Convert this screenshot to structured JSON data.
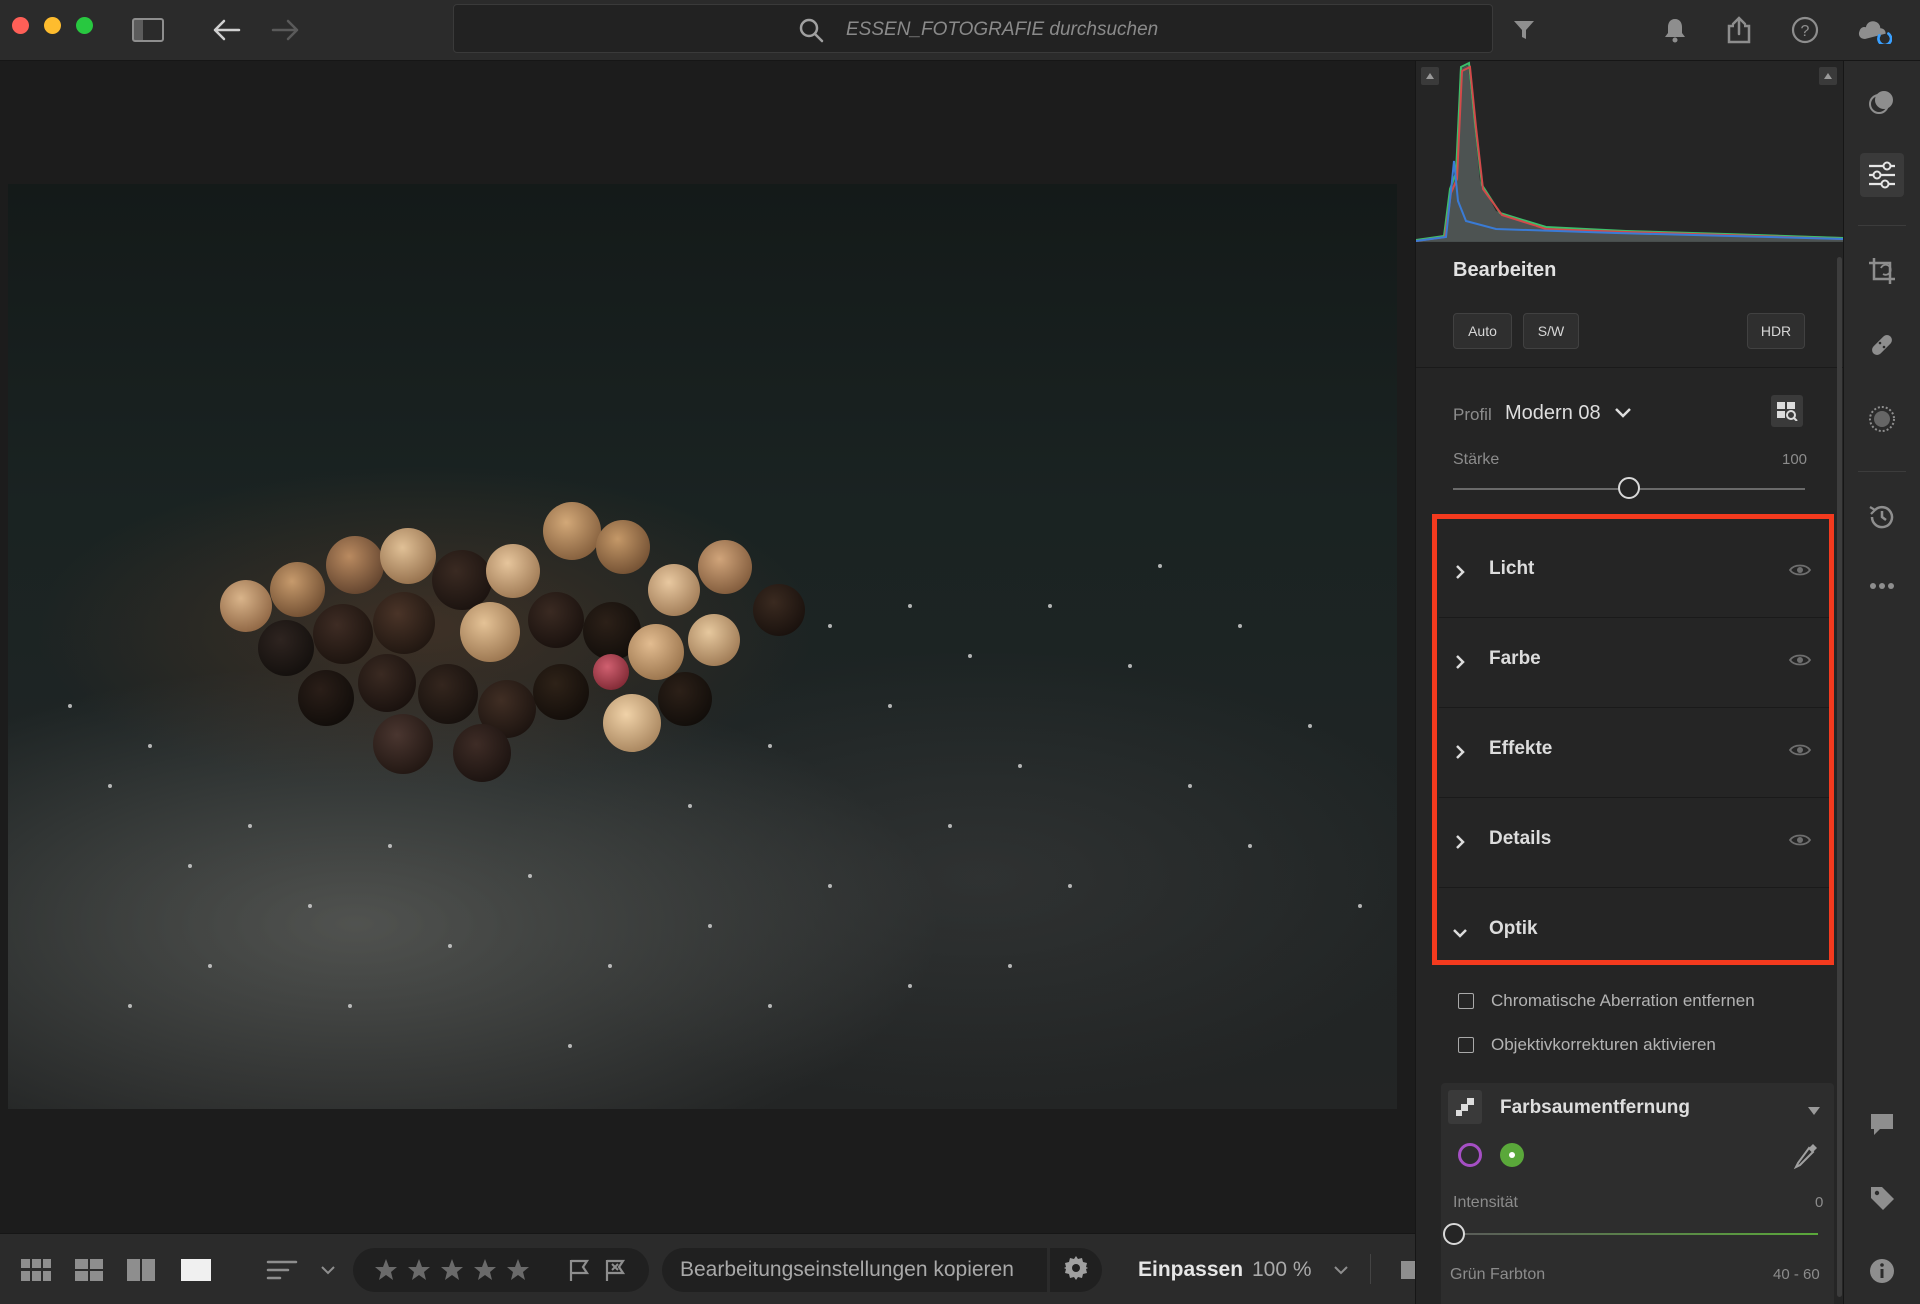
{
  "search": {
    "placeholder": "ESSEN_FOTOGRAFIE durchsuchen"
  },
  "topbar": {
    "icons": [
      "sidebar-toggle-icon",
      "back-arrow-icon",
      "forward-arrow-icon",
      "filter-icon",
      "bell-icon",
      "share-icon",
      "help-icon",
      "cloud-sync-icon"
    ]
  },
  "panel": {
    "title": "Bearbeiten",
    "buttons": {
      "auto": "Auto",
      "bw": "S/W",
      "hdr": "HDR"
    },
    "profile": {
      "label": "Profil",
      "value": "Modern 08"
    },
    "staerke": {
      "label": "Stärke",
      "value": "100",
      "level": 0.5
    },
    "sections": [
      {
        "label": "Licht",
        "expanded": false
      },
      {
        "label": "Farbe",
        "expanded": false
      },
      {
        "label": "Effekte",
        "expanded": false
      },
      {
        "label": "Details",
        "expanded": false
      },
      {
        "label": "Optik",
        "expanded": true
      }
    ],
    "optik": {
      "checkbox1": "Chromatische Aberration entfernen",
      "checkbox2": "Objektivkorrekturen aktivieren",
      "farbsaum": {
        "title": "Farbsaumentfernung",
        "intensitaet_label": "Intensität",
        "intensitaet_value": "0",
        "gruen_label": "Grün Farbton",
        "gruen_value": "40 - 60",
        "purple_color": "#a54fc4",
        "green_color": "#5aa83a"
      }
    }
  },
  "bottombar": {
    "copy_label": "Bearbeitungseinstellungen kopieren",
    "fit_label": "Einpassen",
    "zoom_label": "100 %"
  },
  "colors": {
    "highlight": "#f43a1e"
  }
}
